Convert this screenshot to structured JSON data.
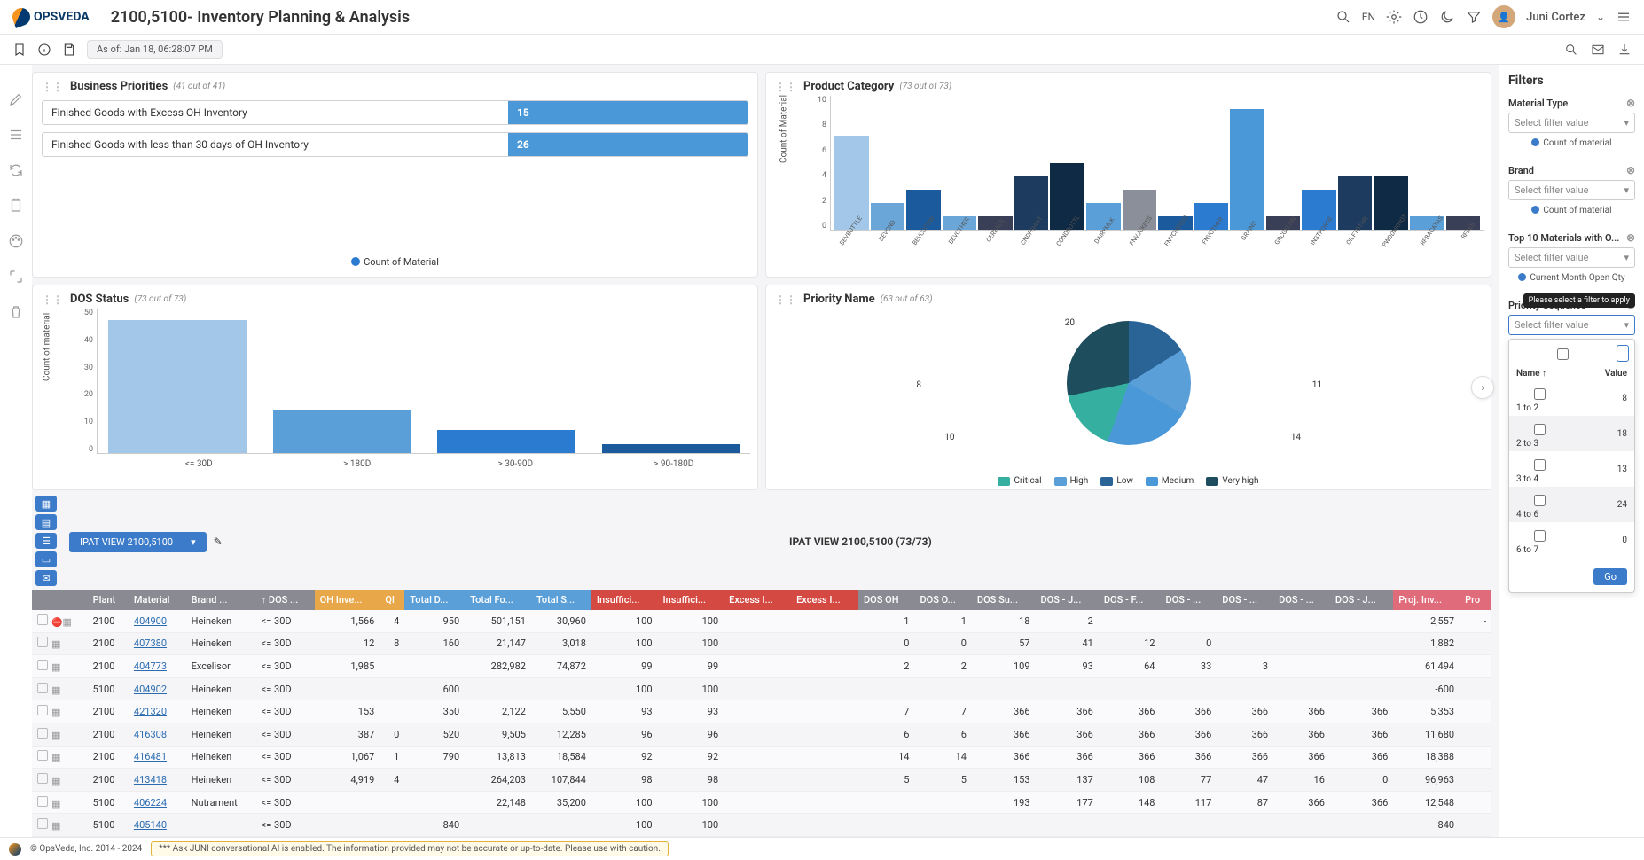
{
  "header": {
    "brand": "OPSVEDA",
    "title": "2100,5100- Inventory Planning & Analysis",
    "lang": "EN",
    "user": "Juni Cortez"
  },
  "subheader": {
    "timestamp": "As of: Jan 18, 06:28:07 PM"
  },
  "panels": {
    "bp": {
      "title": "Business Priorities",
      "sub": "(41 out of 41)",
      "rows": [
        {
          "name": "Finished Goods with Excess OH Inventory",
          "value": "15"
        },
        {
          "name": "Finished Goods with less than 30 days of OH Inventory",
          "value": "26"
        }
      ],
      "legend": "Count of Material"
    },
    "pc": {
      "title": "Product Category",
      "sub": "(73 out of 73)",
      "ylabel": "Count of Material"
    },
    "dos": {
      "title": "DOS Status",
      "sub": "(73 out of 73)",
      "ylabel": "Count of material"
    },
    "pri": {
      "title": "Priority Name",
      "sub": "(63 out of 63)"
    }
  },
  "chart_data": {
    "product_category": {
      "type": "bar",
      "ylabel": "Count of Material",
      "ylim": [
        0,
        10
      ],
      "yticks": [
        0,
        2,
        4,
        6,
        8,
        10
      ],
      "categories": [
        "BEVBOTTLE",
        "BEVCND",
        "BEVCOCOW",
        "BEVOTHER",
        "CEREALS",
        "CNDFSHMT",
        "CONDBOTTL",
        "DAIRYMLK",
        "FNVJCKEES",
        "FNVCNDVEG",
        "FNVOTHER",
        "GRAINS",
        "GRCGELTIN",
        "INSTPORGE",
        "OILFTOTHR",
        "PWDDNKHOT",
        "RFBACATAS",
        "RFDES"
      ],
      "values": [
        7,
        2,
        3,
        1,
        1,
        4,
        5,
        2,
        3,
        1,
        2,
        9,
        1,
        3,
        4,
        4,
        1,
        1
      ],
      "colors": [
        "#a3c7e8",
        "#6aa6d8",
        "#1c5a9e",
        "#6aa6d8",
        "#3a3f58",
        "#1c3b5e",
        "#0f2a44",
        "#5b9fd8",
        "#8a8f99",
        "#1c5a9e",
        "#2b7bd1",
        "#4a98d8",
        "#3a3f58",
        "#2b7bd1",
        "#1c3b5e",
        "#0f2a44",
        "#5b9fd8",
        "#3a3f58"
      ]
    },
    "dos_status": {
      "type": "bar",
      "ylabel": "Count of material",
      "ylim": [
        0,
        50
      ],
      "yticks": [
        0,
        10,
        20,
        30,
        40,
        50
      ],
      "categories": [
        "<= 30D",
        "> 180D",
        "> 30-90D",
        "> 90-180D"
      ],
      "values": [
        46,
        15,
        8,
        3
      ]
    },
    "priority_name": {
      "type": "pie",
      "series": [
        {
          "name": "Critical",
          "value": 10,
          "color": "#35b0a0"
        },
        {
          "name": "High",
          "value": 20,
          "color": "#5b9fd8"
        },
        {
          "name": "Low",
          "value": 8,
          "color": "#2a6496"
        },
        {
          "name": "Medium",
          "value": 11,
          "color": "#4a98d8"
        },
        {
          "name": "Very high",
          "value": 14,
          "color": "#1e4d5e"
        }
      ],
      "annotations": [
        "20",
        "8",
        "11",
        "14",
        "10"
      ]
    }
  },
  "table": {
    "select_label": "IPAT VIEW 2100,5100",
    "title": "IPAT VIEW 2100,5100 (73/73)",
    "columns": [
      "",
      "Plant",
      "Material",
      "Brand ...",
      "↑ DOS ...",
      "OH Inve...",
      "QI",
      "Total D...",
      "Total Fo...",
      "Total S...",
      "Insuffici...",
      "Insuffici...",
      "Excess I...",
      "Excess I...",
      "DOS OH",
      "DOS O...",
      "DOS Su...",
      "DOS - J...",
      "DOS - F...",
      "DOS - ...",
      "DOS - ...",
      "DOS - ...",
      "DOS - J...",
      "Proj. Inv...",
      "Pro"
    ],
    "col_class": [
      "",
      "",
      "",
      "",
      "",
      "h-orange",
      "h-orange",
      "h-blue",
      "h-blue",
      "h-blue",
      "h-red",
      "h-red",
      "h-red",
      "h-red",
      "",
      "",
      "",
      "",
      "",
      "",
      "",
      "",
      "",
      "h-pink",
      "h-pink"
    ],
    "rows": [
      {
        "flag": "red",
        "plant": "2100",
        "material": "404900",
        "brand": "Heineken",
        "dos": "<= 30D",
        "oh": "1,566",
        "qi": "4",
        "td": "950",
        "tf": "501,151",
        "ts": "30,960",
        "i1": "100",
        "i2": "100",
        "e1": "",
        "e2": "",
        "d1": "1",
        "d2": "1",
        "d3": "18",
        "d4": "2",
        "d5": "",
        "d6": "",
        "d7": "",
        "d8": "",
        "d9": "",
        "proj": "2,557",
        "pr": "-"
      },
      {
        "plant": "2100",
        "material": "407380",
        "brand": "Heineken",
        "dos": "<= 30D",
        "oh": "12",
        "qi": "8",
        "td": "160",
        "tf": "21,147",
        "ts": "3,018",
        "i1": "100",
        "i2": "100",
        "e1": "",
        "e2": "",
        "d1": "0",
        "d2": "0",
        "d3": "57",
        "d4": "41",
        "d5": "12",
        "d6": "0",
        "d7": "",
        "d8": "",
        "d9": "",
        "proj": "1,882",
        "pr": ""
      },
      {
        "plant": "2100",
        "material": "404773",
        "brand": "Excelisor",
        "dos": "<= 30D",
        "oh": "1,985",
        "qi": "",
        "td": "",
        "tf": "282,982",
        "ts": "74,872",
        "i1": "99",
        "i2": "99",
        "e1": "",
        "e2": "",
        "d1": "2",
        "d2": "2",
        "d3": "109",
        "d4": "93",
        "d5": "64",
        "d6": "33",
        "d7": "3",
        "d8": "",
        "d9": "",
        "proj": "61,494",
        "pr": ""
      },
      {
        "plant": "5100",
        "material": "404902",
        "brand": "Heineken",
        "dos": "<= 30D",
        "oh": "",
        "qi": "",
        "td": "600",
        "tf": "",
        "ts": "",
        "i1": "100",
        "i2": "100",
        "e1": "",
        "e2": "",
        "d1": "",
        "d2": "",
        "d3": "",
        "d4": "",
        "d5": "",
        "d6": "",
        "d7": "",
        "d8": "",
        "d9": "",
        "proj": "-600",
        "pr": ""
      },
      {
        "plant": "2100",
        "material": "421320",
        "brand": "Heineken",
        "dos": "<= 30D",
        "oh": "153",
        "qi": "",
        "td": "350",
        "tf": "2,122",
        "ts": "5,550",
        "i1": "93",
        "i2": "93",
        "e1": "",
        "e2": "",
        "d1": "7",
        "d2": "7",
        "d3": "366",
        "d4": "366",
        "d5": "366",
        "d6": "366",
        "d7": "366",
        "d8": "366",
        "d9": "366",
        "proj": "5,353",
        "pr": ""
      },
      {
        "plant": "2100",
        "material": "416308",
        "brand": "Heineken",
        "dos": "<= 30D",
        "oh": "387",
        "qi": "0",
        "td": "520",
        "tf": "9,505",
        "ts": "12,285",
        "i1": "96",
        "i2": "96",
        "e1": "",
        "e2": "",
        "d1": "6",
        "d2": "6",
        "d3": "366",
        "d4": "366",
        "d5": "366",
        "d6": "366",
        "d7": "366",
        "d8": "366",
        "d9": "366",
        "proj": "11,680",
        "pr": ""
      },
      {
        "plant": "2100",
        "material": "416481",
        "brand": "Heineken",
        "dos": "<= 30D",
        "oh": "1,067",
        "qi": "1",
        "td": "790",
        "tf": "13,813",
        "ts": "18,584",
        "i1": "92",
        "i2": "92",
        "e1": "",
        "e2": "",
        "d1": "14",
        "d2": "14",
        "d3": "366",
        "d4": "366",
        "d5": "366",
        "d6": "366",
        "d7": "366",
        "d8": "366",
        "d9": "366",
        "proj": "18,388",
        "pr": ""
      },
      {
        "plant": "2100",
        "material": "413418",
        "brand": "Heineken",
        "dos": "<= 30D",
        "oh": "4,919",
        "qi": "4",
        "td": "",
        "tf": "264,203",
        "ts": "107,844",
        "i1": "98",
        "i2": "98",
        "e1": "",
        "e2": "",
        "d1": "5",
        "d2": "5",
        "d3": "153",
        "d4": "137",
        "d5": "108",
        "d6": "77",
        "d7": "47",
        "d8": "16",
        "d9": "0",
        "proj": "96,963",
        "pr": ""
      },
      {
        "plant": "5100",
        "material": "406224",
        "brand": "Nutrament",
        "dos": "<= 30D",
        "oh": "",
        "qi": "",
        "td": "",
        "tf": "22,148",
        "ts": "35,200",
        "i1": "100",
        "i2": "100",
        "e1": "",
        "e2": "",
        "d1": "",
        "d2": "",
        "d3": "193",
        "d4": "177",
        "d5": "148",
        "d6": "117",
        "d7": "87",
        "d8": "366",
        "d9": "366",
        "proj": "12,548",
        "pr": ""
      },
      {
        "plant": "5100",
        "material": "405140",
        "brand": "",
        "dos": "<= 30D",
        "oh": "",
        "qi": "",
        "td": "840",
        "tf": "",
        "ts": "",
        "i1": "100",
        "i2": "100",
        "e1": "",
        "e2": "",
        "d1": "",
        "d2": "",
        "d3": "",
        "d4": "",
        "d5": "",
        "d6": "",
        "d7": "",
        "d8": "",
        "d9": "",
        "proj": "-840",
        "pr": ""
      }
    ]
  },
  "filters": {
    "title": "Filters",
    "placeholder": "Select filter value",
    "search_placeholder": "Search",
    "groups": [
      {
        "label": "Material Type",
        "radio": "Count of material"
      },
      {
        "label": "Brand",
        "radio": "Count of material"
      },
      {
        "label": "Top 10 Materials with O...",
        "radio": "Current Month Open Qty"
      },
      {
        "label": "Priority Sequence",
        "tooltip": "Please select a filter to apply"
      }
    ],
    "popup": {
      "head_name": "Name ↑",
      "head_value": "Value",
      "rows": [
        {
          "name": "1 to 2",
          "value": "8"
        },
        {
          "name": "2 to 3",
          "value": "18"
        },
        {
          "name": "3 to 4",
          "value": "13"
        },
        {
          "name": "4 to 6",
          "value": "24"
        },
        {
          "name": "6 to 7",
          "value": "0"
        }
      ],
      "go": "Go"
    }
  },
  "footer": {
    "copyright": "© OpsVeda, Inc. 2014 - 2024",
    "warning": "*** Ask JUNI conversational AI is enabled. The information provided may not be accurate or up-to-date. Please use with caution."
  }
}
